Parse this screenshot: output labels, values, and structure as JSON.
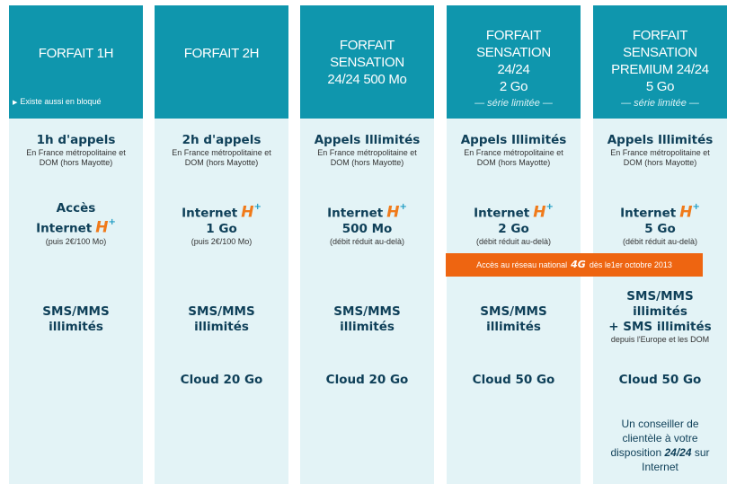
{
  "columns": [
    {
      "header_lines": [
        "FORFAIT 1H"
      ],
      "header_link": "Existe aussi en bloqué",
      "calls": "1h d'appels",
      "calls_note": "En France métropolitaine et DOM (hors Mayotte)",
      "internet_lines": [
        "Accès",
        "Internet"
      ],
      "internet_note": "(puis 2€/100 Mo)",
      "sms_lines": [
        "SMS/MMS",
        "illimités"
      ],
      "cloud": "",
      "extra_text": ""
    },
    {
      "header_lines": [
        "FORFAIT 2H"
      ],
      "calls": "2h d'appels",
      "calls_note": "En France métropolitaine et DOM (hors Mayotte)",
      "internet_lines": [
        "Internet",
        "1 Go"
      ],
      "internet_note": "(puis 2€/100 Mo)",
      "sms_lines": [
        "SMS/MMS",
        "illimités"
      ],
      "cloud": "Cloud 20 Go"
    },
    {
      "header_lines": [
        "FORFAIT SENSATION",
        "24/24 500 Mo"
      ],
      "calls": "Appels Illimités",
      "calls_note": "En France métropolitaine et DOM (hors Mayotte)",
      "internet_lines": [
        "Internet",
        "500 Mo"
      ],
      "internet_note": "(débit réduit au-delà)",
      "sms_lines": [
        "SMS/MMS",
        "illimités"
      ],
      "cloud": "Cloud 20 Go"
    },
    {
      "header_lines": [
        "FORFAIT SENSATION",
        "24/24",
        "2 Go"
      ],
      "header_sub": "— série limitée —",
      "calls": "Appels Illimités",
      "calls_note": "En France métropolitaine et DOM (hors Mayotte)",
      "internet_lines": [
        "Internet",
        "2 Go"
      ],
      "internet_note": "(débit réduit au-delà)",
      "sms_lines": [
        "SMS/MMS",
        "illimités"
      ],
      "cloud": "Cloud 50 Go"
    },
    {
      "header_lines": [
        "FORFAIT SENSATION",
        "PREMIUM 24/24",
        "5 Go"
      ],
      "header_sub": "— série limitée —",
      "calls": "Appels Illimités",
      "calls_note": "En France métropolitaine et DOM (hors Mayotte)",
      "internet_lines": [
        "Internet",
        "5 Go"
      ],
      "internet_note": "(débit réduit au-delà)",
      "sms_lines": [
        "SMS/MMS",
        "illimités",
        "+ SMS illimités"
      ],
      "sms_note": "depuis l'Europe et les DOM",
      "cloud": "Cloud 50 Go",
      "extra_lines": [
        "Un conseiller de",
        "clientèle à votre"
      ],
      "extra_pre": "disposition",
      "extra_em": "24/24",
      "extra_post": "sur",
      "extra_last": "Internet"
    }
  ],
  "hplus": {
    "letter": "H",
    "sup": "+"
  },
  "banner": {
    "before": "Accès au réseau national",
    "badge": "4G",
    "after": "dès le1er octobre 2013"
  },
  "colors": {
    "header_bg": "#0f96ad",
    "column_bg": "#e3f3f6",
    "text_dark": "#0e3f58",
    "accent_orange": "#ee6511",
    "hplus_orange": "#f07a1a"
  }
}
